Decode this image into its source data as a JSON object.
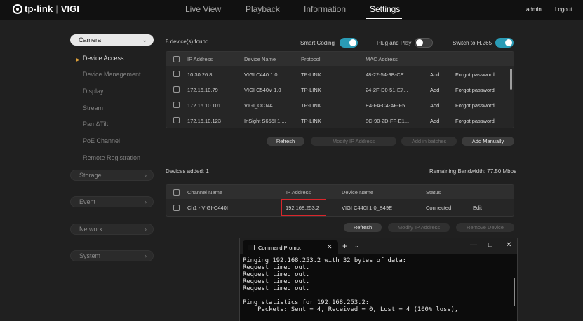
{
  "brand": {
    "name": "tp-link",
    "product": "VIGI"
  },
  "nav": {
    "live_view": "Live View",
    "playback": "Playback",
    "information": "Information",
    "settings": "Settings"
  },
  "user": {
    "name": "admin",
    "logout": "Logout"
  },
  "sidebar": {
    "selector": "Camera",
    "items": [
      "Device Access",
      "Device Management",
      "Display",
      "Stream",
      "Pan &Tilt",
      "PoE Channel",
      "Remote Registration"
    ],
    "groups": [
      "Storage",
      "Event",
      "Network",
      "System"
    ]
  },
  "found": {
    "count_text": "8 device(s) found.",
    "smart_coding": "Smart Coding",
    "plug_and_play": "Plug and Play",
    "switch_h265": "Switch to H.265",
    "headers": [
      "IP Address",
      "Device Name",
      "Protocol",
      "MAC Address"
    ],
    "rows": [
      {
        "ip": "10.30.26.8",
        "name": "VIGI C440 1.0",
        "protocol": "TP-LINK",
        "mac": "48-22-54-9B-CE...",
        "add": "Add",
        "forgot": "Forgot password"
      },
      {
        "ip": "172.16.10.79",
        "name": "VIGI C540V 1.0",
        "protocol": "TP-LINK",
        "mac": "24-2F-D0-51-E7...",
        "add": "Add",
        "forgot": "Forgot password"
      },
      {
        "ip": "172.16.10.101",
        "name": "VIGI_OCNA",
        "protocol": "TP-LINK",
        "mac": "E4-FA-C4-AF-F5...",
        "add": "Add",
        "forgot": "Forgot password"
      },
      {
        "ip": "172.16.10.123",
        "name": "InSight S655I 1....",
        "protocol": "TP-LINK",
        "mac": "8C-90-2D-FF-E1...",
        "add": "Add",
        "forgot": "Forgot password"
      }
    ],
    "buttons": {
      "refresh": "Refresh",
      "modify_ip": "Modify IP Address",
      "add_batches": "Add in batches",
      "add_manually": "Add Manually"
    }
  },
  "added": {
    "count_text": "Devices added: 1",
    "bandwidth": "Remaining Bandwidth: 77.50 Mbps",
    "headers": [
      "Channel Name",
      "IP Address",
      "Device Name",
      "Status"
    ],
    "row": {
      "channel": "Ch1 - VIGI-C440I",
      "ip": "192.168.253.2",
      "device": "VIGI C440I 1.0_B49E",
      "status": "Connected",
      "edit": "Edit"
    },
    "buttons": {
      "refresh": "Refresh",
      "modify_ip": "Modify IP Address",
      "remove": "Remove Device"
    }
  },
  "cmd": {
    "title": "Command Prompt",
    "lines": [
      "Pinging 192.168.253.2 with 32 bytes of data:",
      "Request timed out.",
      "Request timed out.",
      "Request timed out.",
      "Request timed out.",
      "",
      "Ping statistics for 192.168.253.2:",
      "    Packets: Sent = 4, Received = 0, Lost = 4 (100% loss),"
    ]
  }
}
